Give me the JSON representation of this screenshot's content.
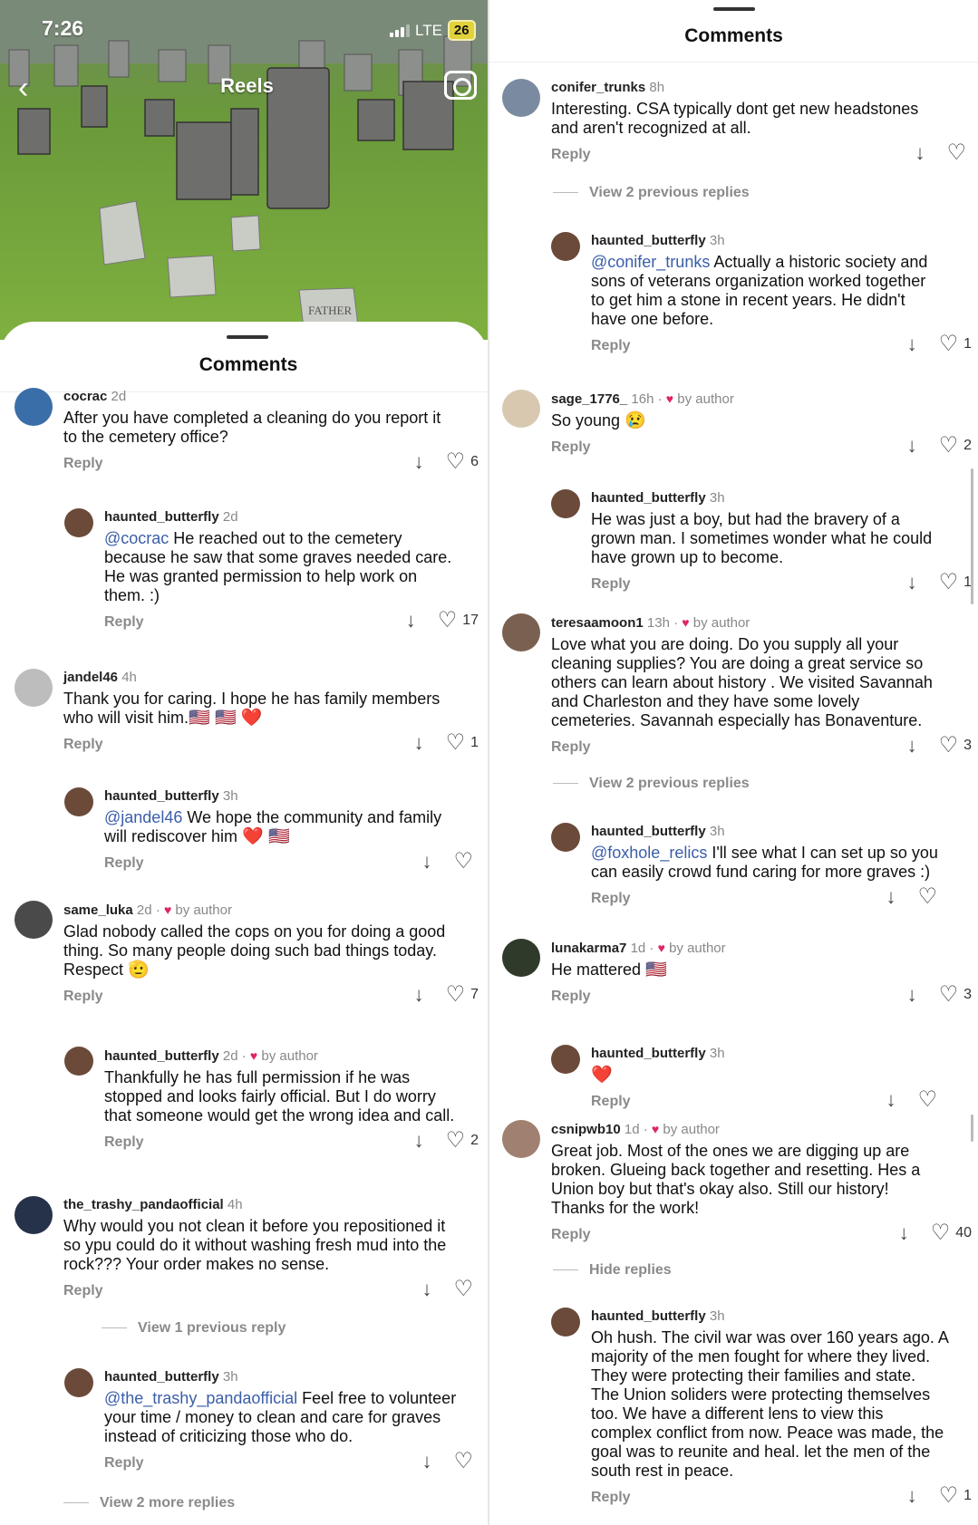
{
  "status": {
    "time": "7:26",
    "network": "LTE",
    "battery": "26"
  },
  "header": {
    "reels_label": "Reels",
    "comments_title": "Comments"
  },
  "left": {
    "comments": [
      {
        "user": "cocrac",
        "time": "2d",
        "author": "",
        "text": "After you have completed a cleaning do you report it\nto the cemetery office?",
        "reply": "Reply",
        "likes": "6"
      },
      {
        "user": "haunted_butterfly",
        "time": "2d",
        "author": "",
        "mention": "@cocrac",
        "text": " He reached out to the cemetery\nbecause he saw that some graves needed care.\nHe was granted permission to help work on\nthem. :)",
        "reply": "Reply",
        "likes": "17"
      },
      {
        "user": "jandel46",
        "time": "4h",
        "author": "",
        "text": "Thank you for caring.  I hope he has family members\nwho will visit him.",
        "emoji": "🇺🇸 🇺🇸 ❤️",
        "reply": "Reply",
        "likes": "1"
      },
      {
        "user": "haunted_butterfly",
        "time": "3h",
        "author": "",
        "mention": "@jandel46",
        "text": " We hope the community and family\nwill rediscover him ",
        "emoji": "❤️ 🇺🇸",
        "reply": "Reply",
        "likes": ""
      },
      {
        "user": "same_luka",
        "time": "2d",
        "author": "by author",
        "text": "Glad nobody called the cops on you for doing a good\nthing. So many people doing such bad things today.\nRespect ",
        "emoji": "🫡",
        "reply": "Reply",
        "likes": "7"
      },
      {
        "user": "haunted_butterfly",
        "time": "2d",
        "author": "by author",
        "text": "Thankfully he has full permission if he was\nstopped and looks fairly official. But I do worry\nthat someone would get the wrong idea and call.",
        "reply": "Reply",
        "likes": "2"
      },
      {
        "user": "the_trashy_pandaofficial",
        "time": "4h",
        "author": "",
        "text": "Why would you not clean it before you repositioned it\nso ypu could do it without washing fresh mud into the\nrock??? Your order makes no sense.",
        "reply": "Reply",
        "likes": ""
      },
      {
        "user": "haunted_butterfly",
        "time": "3h",
        "author": "",
        "mention": "@the_trashy_pandaofficial",
        "text": " Feel free to volunteer\nyour time / money to clean and care for graves\ninstead of criticizing those who do.",
        "reply": "Reply",
        "likes": ""
      }
    ],
    "view_prev": "View 1 previous reply",
    "view_more": "View 2 more replies"
  },
  "right": {
    "comments": [
      {
        "user": "conifer_trunks",
        "time": "8h",
        "author": "",
        "text": "Interesting. CSA typically dont get new headstones\nand aren't recognized at all.",
        "reply": "Reply",
        "likes": ""
      },
      {
        "user": "haunted_butterfly",
        "time": "3h",
        "author": "",
        "mention": "@conifer_trunks",
        "text": " Actually a historic society and\nsons of veterans organization worked together\nto get him a stone in recent years. He didn't\nhave one before.",
        "reply": "Reply",
        "likes": "1"
      },
      {
        "user": "sage_1776_",
        "time": "16h",
        "author": "by author",
        "text": "So young ",
        "emoji": "😢",
        "reply": "Reply",
        "likes": "2"
      },
      {
        "user": "haunted_butterfly",
        "time": "3h",
        "author": "",
        "text": "He was just a boy, but had the bravery of a\ngrown man. I sometimes wonder what he could\nhave grown up to become.",
        "reply": "Reply",
        "likes": "1"
      },
      {
        "user": "teresaamoon1",
        "time": "13h",
        "author": "by author",
        "text": "Love what you are doing. Do you supply all your\ncleaning supplies? You are doing a great service so\nothers can learn about history . We visited Savannah\nand Charleston and they have some lovely\ncemeteries. Savannah especially has Bonaventure.",
        "reply": "Reply",
        "likes": "3"
      },
      {
        "user": "haunted_butterfly",
        "time": "3h",
        "author": "",
        "mention": "@foxhole_relics",
        "text": " I'll see what I can set up so you\ncan easily crowd fund caring for more graves :)",
        "reply": "Reply",
        "likes": ""
      },
      {
        "user": "lunakarma7",
        "time": "1d",
        "author": "by author",
        "text": "He mattered ",
        "emoji": "🇺🇸",
        "reply": "Reply",
        "likes": "3"
      },
      {
        "user": "haunted_butterfly",
        "time": "3h",
        "author": "",
        "text": "",
        "emoji": "❤️",
        "reply": "Reply",
        "likes": ""
      },
      {
        "user": "csnipwb10",
        "time": "1d",
        "author": "by author",
        "text": "Great job.  Most of the ones we are digging up are\nbroken.  Glueing back together and resetting.  Hes a\nUnion boy but that's okay also.  Still our history!\nThanks for the work!",
        "reply": "Reply",
        "likes": "40"
      },
      {
        "user": "haunted_butterfly",
        "time": "3h",
        "author": "",
        "text": "Oh hush. The civil war was over 160 years ago. A\nmajority of the men fought for where they lived.\nThey were protecting their families and state.\nThe Union soliders were protecting themselves\ntoo. We have a different lens to view this\ncomplex conflict from now. Peace was made, the\ngoal was to reunite and heal. let the men of the\nsouth rest in peace.",
        "reply": "Reply",
        "likes": "1"
      }
    ],
    "view_prev_1": "View 2 previous replies",
    "view_prev_2": "View 2 previous replies",
    "hide_replies": "Hide replies"
  },
  "hero_stone_text": "FATHER",
  "colors": {
    "accent_mention": "#3b5ea8",
    "heart_red": "#e0245e",
    "grass": "#5f8f2e"
  }
}
